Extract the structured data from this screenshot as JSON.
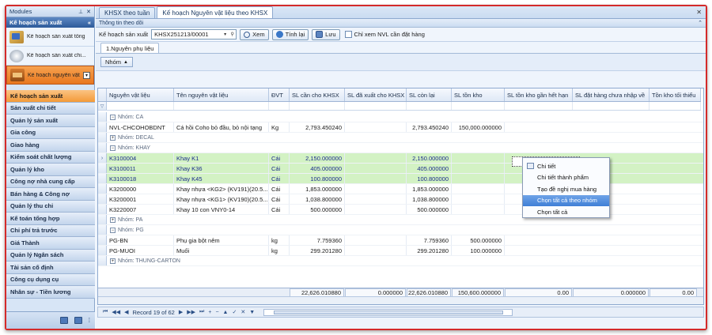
{
  "sidebar": {
    "header": "Modules",
    "group_title": "Kế hoạch sản xuất",
    "subitems": [
      {
        "label": "Kế hoạch sản xuất tổng",
        "icon": "stack-icon"
      },
      {
        "label": "Kế hoạch sản xuất chi...",
        "icon": "disc-icon"
      },
      {
        "label": "Kế hoạch nguyên vật",
        "icon": "box-icon"
      }
    ],
    "menu": [
      "Kế hoạch sản xuất",
      "Sản xuất chi tiết",
      "Quản lý sản xuất",
      "Gia công",
      "Giao hàng",
      "Kiểm soát chất lượng",
      "Quản lý kho",
      "Công nợ nhà cung cấp",
      "Bán hàng & Công nợ",
      "Quản lý thu chi",
      "Kế toán tổng hợp",
      "Chi phí trả trước",
      "Giá Thành",
      "Quản lý Ngân sách",
      "Tài sản cố định",
      "Công cụ dụng cụ",
      "Nhân sự - Tiền lương"
    ]
  },
  "tabs": [
    "KHSX theo tuần",
    "Kế hoạch Nguyên vật liệu theo KHSX"
  ],
  "toolbar": {
    "section_title": "Thông tin theo dõi",
    "plan_label": "Kế hoạch sản xuất",
    "plan_value": "KHSX251213/00001",
    "view_label": "Xem",
    "calc_label": "Tính lại",
    "save_label": "Lưu",
    "only_need_label": "Chỉ xem NVL cần đặt hàng"
  },
  "subtab": "1.Nguyên phụ liệu",
  "group_chip": "Nhóm",
  "grid": {
    "columns": [
      "Nguyên vật liệu",
      "Tên nguyên vật liệu",
      "ĐVT",
      "SL cần cho KHSX",
      "SL đã xuất cho KHSX",
      "SL còn lại",
      "SL tồn kho",
      "SL tồn kho gần hết hạn",
      "SL đặt hàng chưa nhập về",
      "Tồn kho tối thiểu"
    ],
    "groups": {
      "ca": "Nhóm: CA",
      "decal": "Nhóm: DECAL",
      "khay": "Nhóm: KHAY",
      "pa": "Nhóm: PA",
      "pg": "Nhóm: PG",
      "thung": "Nhóm: THUNG-CARTON"
    },
    "rows": {
      "r1": [
        "NVL-CHCOHOBDNT",
        "Cá hồi Coho bỏ đầu, bỏ nội tạng",
        "Kg",
        "2,793.450240",
        "",
        "2,793.450240",
        "150,000.000000"
      ],
      "r2": [
        "K3100004",
        "Khay K1",
        "Cái",
        "2,150.000000",
        "",
        "2,150.000000",
        ""
      ],
      "r3": [
        "K3100011",
        "Khay K36",
        "Cái",
        "405.000000",
        "",
        "405.000000",
        ""
      ],
      "r4": [
        "K3100018",
        "Khay K45",
        "Cái",
        "100.800000",
        "",
        "100.800000",
        ""
      ],
      "r5": [
        "K3200000",
        "Khay nhựa <KG2> (KV191)(20.5...",
        "Cái",
        "1,853.000000",
        "",
        "1,853.000000",
        ""
      ],
      "r6": [
        "K3200001",
        "Khay nhựa <KG1> (KV190)(20.5...",
        "Cái",
        "1,038.800000",
        "",
        "1,038.800000",
        ""
      ],
      "r7": [
        "K3220007",
        "Khay 10 con VNY0-14",
        "Cái",
        "500.000000",
        "",
        "500.000000",
        ""
      ],
      "r8": [
        "PG-BN",
        "Phụ gia bột nêm",
        "kg",
        "7.759360",
        "",
        "7.759360",
        "500.000000"
      ],
      "r9": [
        "PG-MUOI",
        "Muối",
        "kg",
        "299.201280",
        "",
        "299.201280",
        "100.000000"
      ]
    },
    "totals": [
      "22,626.010880",
      "0.000000",
      "22,626.010880",
      "150,600.000000",
      "0.00",
      "0.000000",
      "0.00"
    ]
  },
  "navigator": {
    "record_text": "Record 19 of 62"
  },
  "context_menu": [
    "Chi tiết",
    "Chi tiết thành phẩm",
    "Tạo đề nghị mua hàng",
    "Chọn tất cả theo nhóm",
    "Chọn tất cả"
  ]
}
